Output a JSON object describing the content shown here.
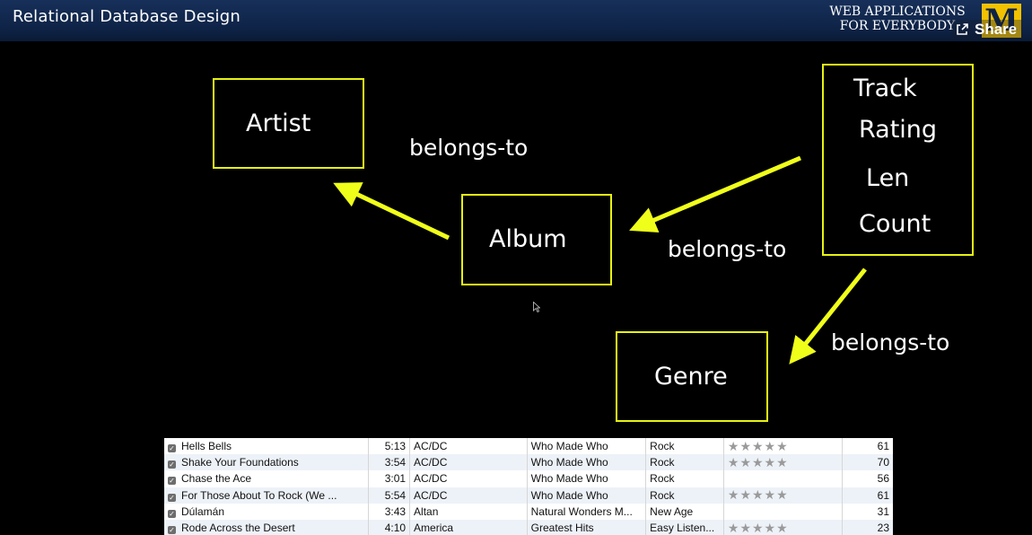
{
  "header": {
    "title": "Relational Database Design",
    "brand_line1": "WEB APPLICATIONS",
    "brand_line2": "FOR EVERYBODY",
    "logo_letter": "M",
    "share_label": "Share"
  },
  "diagram": {
    "nodes": {
      "artist": "Artist",
      "album": "Album",
      "genre": "Genre",
      "track": [
        "Track",
        "Rating",
        "Len",
        "Count"
      ]
    },
    "edges": {
      "album_artist": "belongs-to",
      "track_album": "belongs-to",
      "track_genre": "belongs-to"
    },
    "box_color": "#e6f214",
    "arrow_color": "#f0ff1a"
  },
  "table": {
    "rows": [
      {
        "name": "Hells Bells",
        "time": "5:13",
        "artist": "AC/DC",
        "album": "Who Made Who",
        "genre": "Rock",
        "rating": "★★★★★",
        "count": "61"
      },
      {
        "name": "Shake Your Foundations",
        "time": "3:54",
        "artist": "AC/DC",
        "album": "Who Made Who",
        "genre": "Rock",
        "rating": "★★★★★",
        "count": "70"
      },
      {
        "name": "Chase the Ace",
        "time": "3:01",
        "artist": "AC/DC",
        "album": "Who Made Who",
        "genre": "Rock",
        "rating": "",
        "count": "56"
      },
      {
        "name": "For Those About To Rock (We ...",
        "time": "5:54",
        "artist": "AC/DC",
        "album": "Who Made Who",
        "genre": "Rock",
        "rating": "★★★★★",
        "count": "61"
      },
      {
        "name": "Dúlamán",
        "time": "3:43",
        "artist": "Altan",
        "album": "Natural Wonders M...",
        "genre": "New Age",
        "rating": "",
        "count": "31"
      },
      {
        "name": "Rode Across the Desert",
        "time": "4:10",
        "artist": "America",
        "album": "Greatest Hits",
        "genre": "Easy Listen...",
        "rating": "★★★★★",
        "count": "23"
      }
    ]
  }
}
